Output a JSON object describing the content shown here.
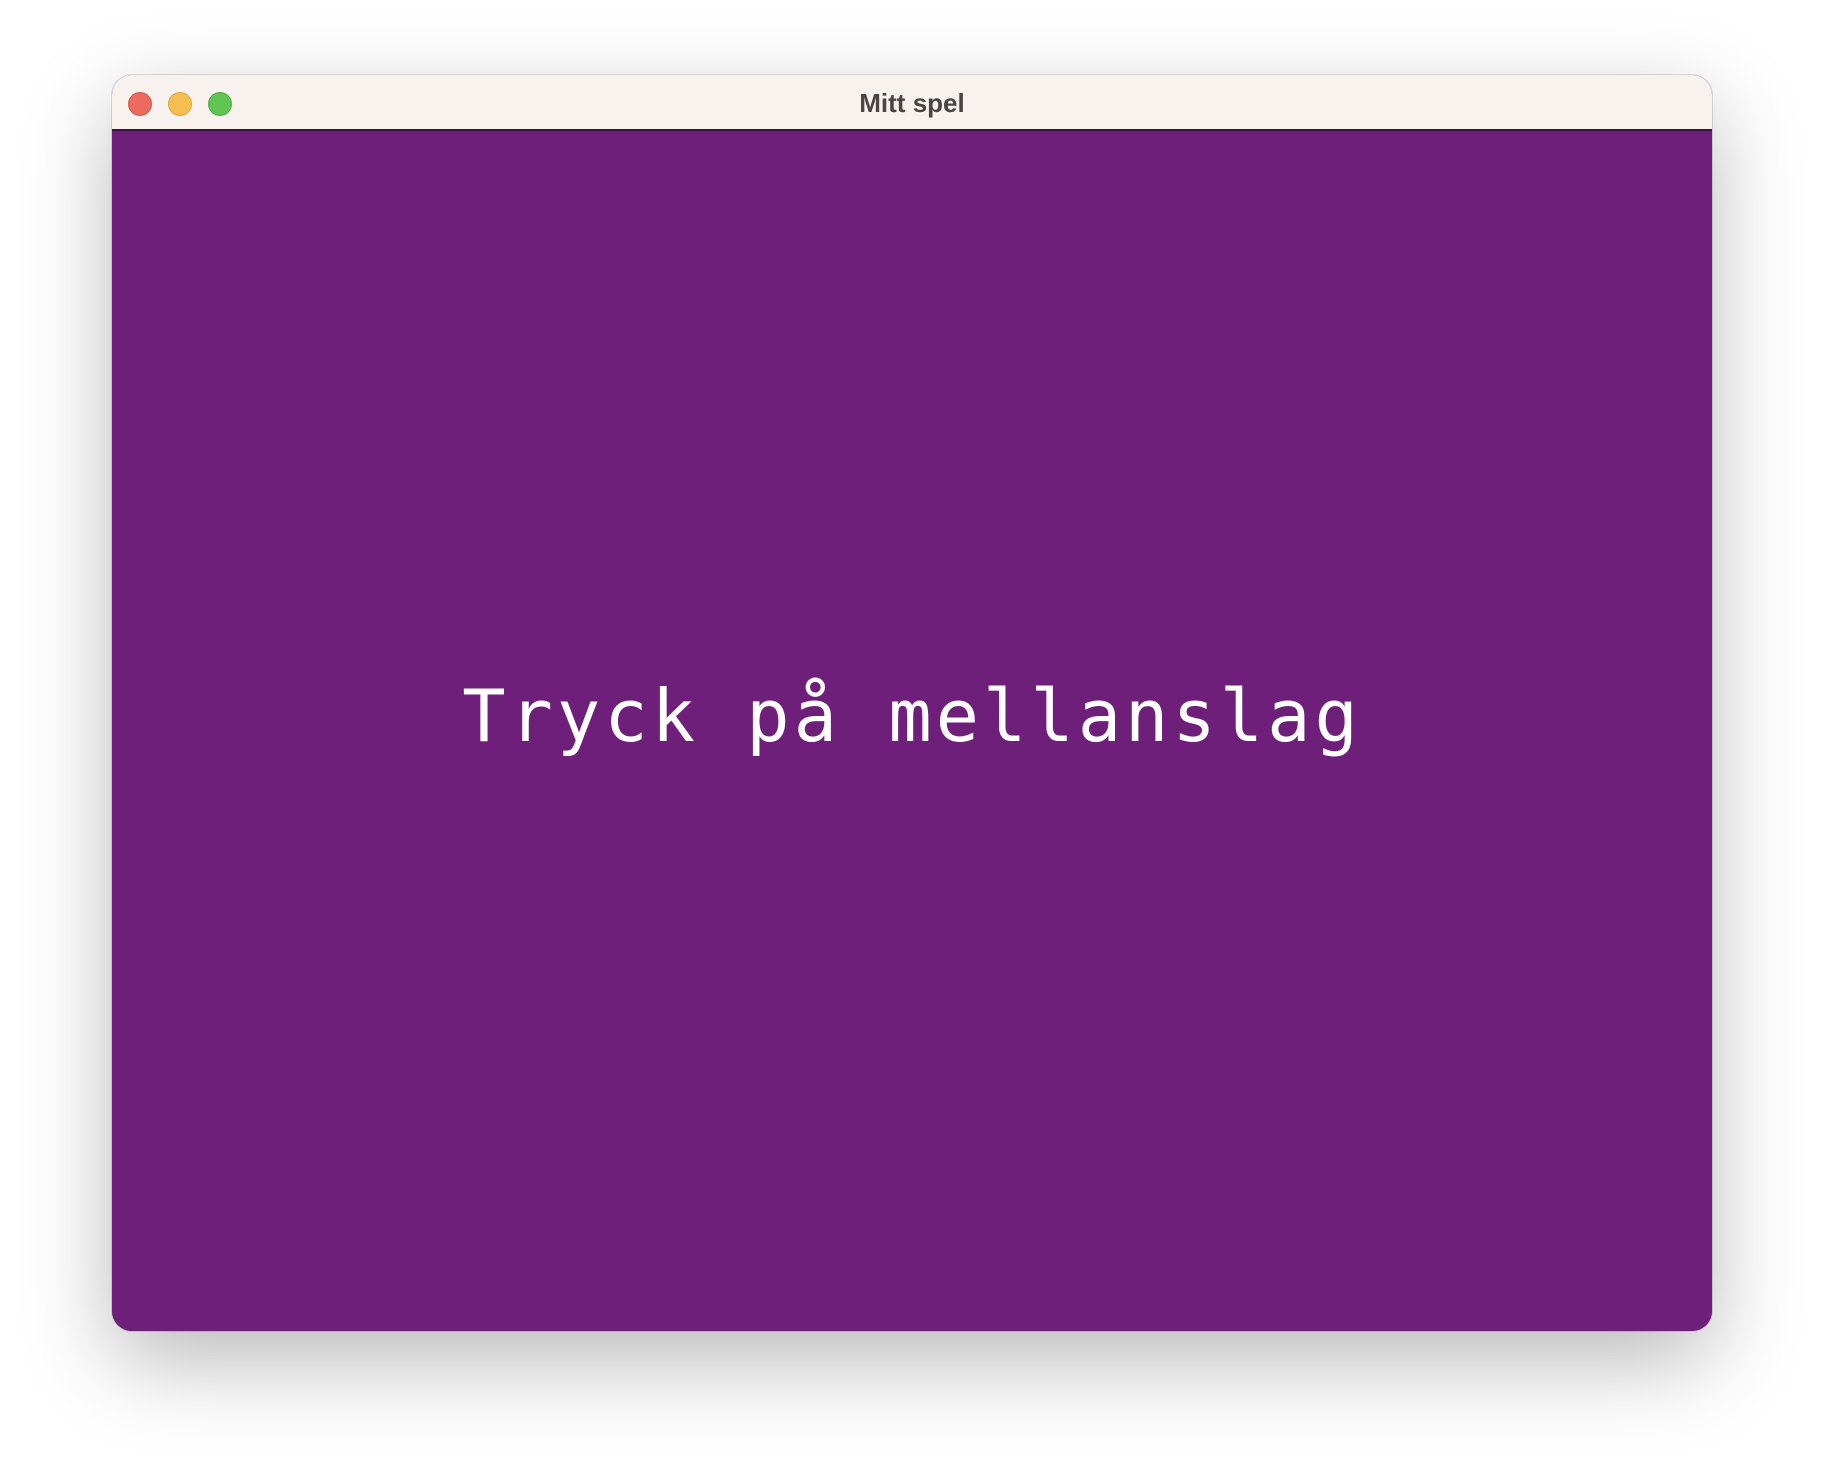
{
  "window": {
    "title": "Mitt spel"
  },
  "game": {
    "prompt": "Tryck på mellanslag",
    "background_color": "#6e1f79",
    "text_color": "#ffffff"
  },
  "titlebar_buttons": [
    {
      "name": "close",
      "color": "#ee6a5e"
    },
    {
      "name": "minimize",
      "color": "#f5bf4f"
    },
    {
      "name": "zoom",
      "color": "#61c554"
    }
  ]
}
